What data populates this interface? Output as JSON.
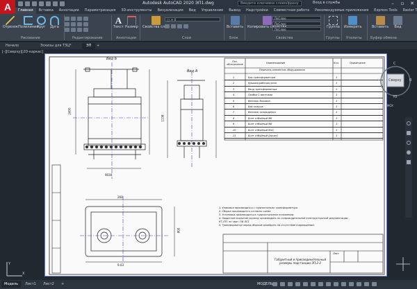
{
  "app": {
    "logo_letter": "A",
    "window_title": "Autodesk AutoCAD 2020   ЭП1.dwg",
    "search_placeholder": "Введите ключевое слово/фразу",
    "signin_label": "Вход в службы",
    "brand_color": "#c4141c"
  },
  "menu_tabs": [
    "Главная",
    "Вставка",
    "Аннотации",
    "Параметризация",
    "3D-инструменты",
    "Визуализация",
    "Вид",
    "Управление",
    "Вывод",
    "Надстройки",
    "Совместная работа",
    "Рекомендуемые приложения",
    "Express Tools",
    "Raster Tools"
  ],
  "ribbon": {
    "buttons": [
      "Отрезок",
      "Полилиния",
      "Круг",
      "Дуга",
      "Текст",
      "Размер",
      "Свойства слоя",
      "Вставить",
      "Копировать свойства",
      "Группа",
      "Утилиты",
      "Измерить",
      "Буфер обмена",
      "Вид"
    ],
    "groups": [
      "Рисование",
      "Редактирование",
      "Аннотации",
      "Слои",
      "Блок",
      "Свойства",
      "Группы",
      "Утилиты",
      "Буфер обмена"
    ],
    "prop_values": [
      "ПоСлою",
      "ПоСлою",
      "ПоСлою"
    ]
  },
  "doc_tabs": [
    "Начало",
    "Эскизы для ТЗЦ*",
    "ЭП"
  ],
  "viewport": {
    "label": "[-][Сверху][2D-каркас]",
    "viewcube_face": "Сверху",
    "compass": {
      "n": "С",
      "s": "Ю",
      "e": "В",
      "w": "З"
    },
    "wcs_label": "МСК"
  },
  "drawing": {
    "view_b_label": "Вид Б",
    "view_a_label": "Вид А",
    "dims": [
      "260",
      "9.03",
      "1138",
      "2400",
      "800",
      "9030"
    ],
    "table_headers": [
      "Поз. обозначение",
      "Наименование",
      "Кол.",
      "Примечание"
    ],
    "table_title": "Перечень элементов оборудования",
    "table_rows": [
      {
        "pos": "1",
        "name": "Бак трансформатора",
        "qty": "1"
      },
      {
        "pos": "2",
        "name": "Крышка рабочая низа",
        "qty": "1"
      },
      {
        "pos": "3",
        "name": "Ввод трансформатора",
        "qty": "1"
      },
      {
        "pos": "4",
        "name": "Пробка 1 винтовая",
        "qty": "1"
      },
      {
        "pos": "5",
        "name": "Вентиль боковой",
        "qty": "1"
      },
      {
        "pos": "6",
        "name": "Бак кожуха",
        "qty": "1"
      },
      {
        "pos": "7",
        "name": "Вентиль охлаждения",
        "qty": "1"
      },
      {
        "pos": "8",
        "name": "Болт отбойный М6",
        "qty": "1"
      },
      {
        "pos": "9",
        "name": "Болт отбойный М8",
        "qty": "1"
      },
      {
        "pos": "10",
        "name": "Болт отбойный М10",
        "qty": "1"
      },
      {
        "pos": "11",
        "name": "Болт отбойный (рычаг)",
        "qty": "1"
      }
    ],
    "notes": [
      "1. Упаковка производится с горизонтально трансформатора.",
      "2. Сборка производится согласно схеме.",
      "3. Установка производится в горизонтальном положении.",
      "4. Защитное покрытие окраску производить по сопроводительной конструкторской документации.",
      "   КТ-ЛТ1   по   черт. ГФ-ЛС1",
      "5. Трансформатор перед сборкой проверить на отсутствие повреждений."
    ],
    "stamp_title": "Габаритный и присоединительный размеры подстанции ЭП-2-2",
    "stamp_sheet": "Лист"
  },
  "status": {
    "tabs": [
      "Модель",
      "Лист1",
      "Лист2"
    ],
    "model_label": "МОДЕЛЬ"
  }
}
